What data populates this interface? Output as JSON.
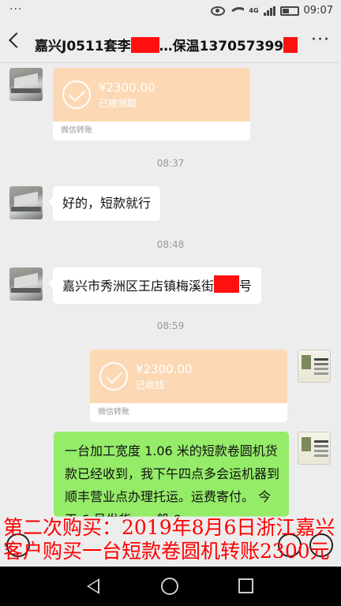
{
  "status_bar": {
    "dots": "···",
    "network": "4G",
    "network_sub": "4G 2G",
    "time": "09:07"
  },
  "header": {
    "title_prefix": "嘉兴J0511套李",
    "title_middle": "…保温137057399",
    "more_icon": "more-icon"
  },
  "messages": {
    "transfer1": {
      "amount": "¥2300.00",
      "status": "已被领取",
      "label": "微信转账"
    },
    "time1": "08:37",
    "msg1": "好的，短款就行",
    "time2": "08:48",
    "msg2_prefix": "嘉兴市秀洲区王店镇梅溪街",
    "msg2_suffix": "号",
    "time3": "08:59",
    "transfer2": {
      "amount": "¥2300.00",
      "status": "已收钱",
      "label": "微信转账"
    },
    "msg3": "一台加工宽度 1.06 米的短款卷圆机货款已经收到，我下午四点多会运机器到顺丰营业点办理托运。运费寄付。 今天 6 号发货，一般 8"
  },
  "caption": {
    "line1": "第二次购买：2019年8月6日浙江嘉兴",
    "line2": "客户购买一台短款卷圆机转账2300元"
  },
  "colors": {
    "transfer_bg": "#fcd9b4",
    "my_bubble": "#95ec69",
    "redaction": "#ff1010",
    "caption": "#ff0000"
  }
}
